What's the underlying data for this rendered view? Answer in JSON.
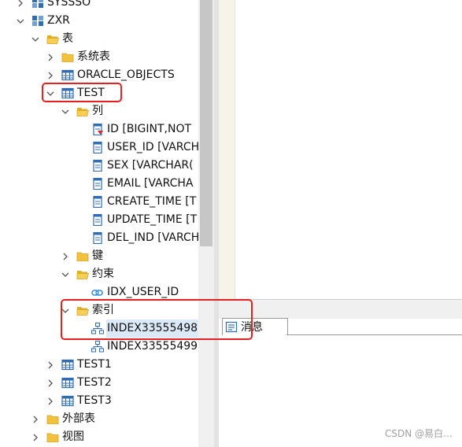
{
  "tree": [
    {
      "label": "SYSSSO",
      "depth": 0,
      "icon": "schema-icon",
      "expander": "collapsed"
    },
    {
      "label": "ZXR",
      "depth": 0,
      "icon": "schema-icon",
      "expander": "expanded"
    },
    {
      "label": "表",
      "depth": 1,
      "icon": "folder-open-icon",
      "expander": "expanded"
    },
    {
      "label": "系统表",
      "depth": 2,
      "icon": "folder-icon",
      "expander": "collapsed"
    },
    {
      "label": "ORACLE_OBJECTS",
      "depth": 2,
      "icon": "table-icon",
      "expander": "collapsed"
    },
    {
      "label": "TEST",
      "depth": 2,
      "icon": "table-icon",
      "expander": "expanded"
    },
    {
      "label": "列",
      "depth": 3,
      "icon": "folder-open-icon",
      "expander": "expanded"
    },
    {
      "label": "ID [BIGINT,NOT",
      "depth": 4,
      "icon": "primary-key-column-icon",
      "expander": "none"
    },
    {
      "label": "USER_ID [VARCH",
      "depth": 4,
      "icon": "column-icon",
      "expander": "none"
    },
    {
      "label": "SEX [VARCHAR(",
      "depth": 4,
      "icon": "column-icon",
      "expander": "none"
    },
    {
      "label": "EMAIL [VARCHA",
      "depth": 4,
      "icon": "column-icon",
      "expander": "none"
    },
    {
      "label": "CREATE_TIME [T",
      "depth": 4,
      "icon": "column-icon",
      "expander": "none"
    },
    {
      "label": "UPDATE_TIME [T",
      "depth": 4,
      "icon": "column-icon",
      "expander": "none"
    },
    {
      "label": "DEL_IND [VARCH",
      "depth": 4,
      "icon": "column-icon",
      "expander": "none"
    },
    {
      "label": "键",
      "depth": 3,
      "icon": "folder-icon",
      "expander": "collapsed"
    },
    {
      "label": "约束",
      "depth": 3,
      "icon": "folder-open-icon",
      "expander": "expanded"
    },
    {
      "label": "IDX_USER_ID",
      "depth": 4,
      "icon": "constraint-icon",
      "expander": "none"
    },
    {
      "label": "索引",
      "depth": 3,
      "icon": "folder-open-icon",
      "expander": "expanded"
    },
    {
      "label": "INDEX33555498",
      "depth": 4,
      "icon": "index-icon",
      "expander": "none",
      "selected": true
    },
    {
      "label": "INDEX33555499",
      "depth": 4,
      "icon": "index-icon",
      "expander": "none"
    },
    {
      "label": "TEST1",
      "depth": 2,
      "icon": "table-icon",
      "expander": "collapsed"
    },
    {
      "label": "TEST2",
      "depth": 2,
      "icon": "table-icon",
      "expander": "collapsed"
    },
    {
      "label": "TEST3",
      "depth": 2,
      "icon": "table-icon",
      "expander": "collapsed"
    },
    {
      "label": "外部表",
      "depth": 1,
      "icon": "folder-icon",
      "expander": "collapsed"
    },
    {
      "label": "视图",
      "depth": 1,
      "icon": "folder-icon",
      "expander": "collapsed"
    }
  ],
  "messages_tab": {
    "label": "消息",
    "icon": "message-icon"
  },
  "watermark": "CSDN @易白…",
  "colors": {
    "highlight": "#e52020",
    "folder": "#f2c23c",
    "table": "#2f6db5",
    "selected": "#dbe9f8"
  }
}
